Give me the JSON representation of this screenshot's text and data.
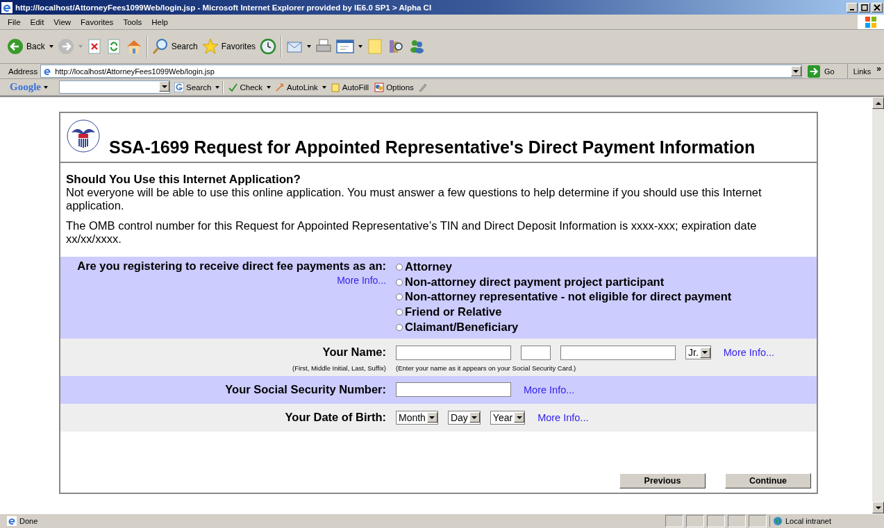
{
  "window": {
    "title": "http://localhost/AttorneyFees1099Web/login.jsp - Microsoft Internet Explorer provided by IE6.0 SP1 > Alpha CI"
  },
  "menu": [
    "File",
    "Edit",
    "View",
    "Favorites",
    "Tools",
    "Help"
  ],
  "toolbar": {
    "back": "Back",
    "search": "Search",
    "favorites": "Favorites"
  },
  "address": {
    "label": "Address",
    "value": "http://localhost/AttorneyFees1099Web/login.jsp",
    "go": "Go",
    "links": "Links",
    "more": "»"
  },
  "google_toolbar": {
    "logo": "Google",
    "search": "Search",
    "check": "Check",
    "autolink": "AutoLink",
    "autofill": "AutoFill",
    "options": "Options"
  },
  "page": {
    "title": "SSA-1699 Request for Appointed Representative's Direct Payment Information",
    "heading": "Should You Use this Internet Application?",
    "paragraphs": [
      "Not everyone will be able to use this online application. You must answer a few questions to help determine if you should use this Internet application.",
      "The OMB control number for this Request for Appointed Representative’s TIN and Direct Deposit Information is xxxx-xxx; expiration date xx/xx/xxxx."
    ],
    "registering": {
      "label": "Are you registering to receive direct fee payments as an:",
      "more_info": "More Info...",
      "options": [
        {
          "label": "Attorney",
          "selected": false
        },
        {
          "label": "Non-attorney direct payment project participant",
          "selected": false
        },
        {
          "label": "Non-attorney representative - not eligible for direct payment",
          "selected": false
        },
        {
          "label": "Friend or Relative",
          "selected": false
        },
        {
          "label": "Claimant/Beneficiary",
          "selected": false
        }
      ]
    },
    "name": {
      "label": "Your Name:",
      "hint": "(First, Middle Initial, Last, Suffix)",
      "suffix": "Jr.",
      "more_info": "More Info...",
      "note": "(Enter your name as it appears on your Social Security Card.)"
    },
    "ssn": {
      "label": "Your Social Security Number:",
      "more_info": "More Info..."
    },
    "dob": {
      "label": "Your Date of Birth:",
      "month": "Month",
      "day": "Day",
      "year": "Year",
      "more_info": "More Info..."
    },
    "buttons": [
      "Previous",
      "Continue"
    ]
  },
  "status_bar": {
    "text": "Done",
    "zone": "Local intranet"
  }
}
